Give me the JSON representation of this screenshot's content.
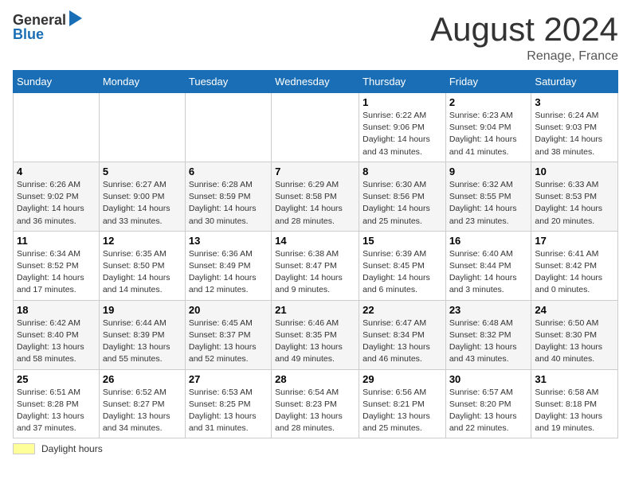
{
  "header": {
    "logo_general": "General",
    "logo_blue": "Blue",
    "month_title": "August 2024",
    "subtitle": "Renage, France"
  },
  "days_of_week": [
    "Sunday",
    "Monday",
    "Tuesday",
    "Wednesday",
    "Thursday",
    "Friday",
    "Saturday"
  ],
  "footer": {
    "legend_label": "Daylight hours"
  },
  "weeks": [
    [
      {
        "day": "",
        "info": ""
      },
      {
        "day": "",
        "info": ""
      },
      {
        "day": "",
        "info": ""
      },
      {
        "day": "",
        "info": ""
      },
      {
        "day": "1",
        "info": "Sunrise: 6:22 AM\nSunset: 9:06 PM\nDaylight: 14 hours and 43 minutes."
      },
      {
        "day": "2",
        "info": "Sunrise: 6:23 AM\nSunset: 9:04 PM\nDaylight: 14 hours and 41 minutes."
      },
      {
        "day": "3",
        "info": "Sunrise: 6:24 AM\nSunset: 9:03 PM\nDaylight: 14 hours and 38 minutes."
      }
    ],
    [
      {
        "day": "4",
        "info": "Sunrise: 6:26 AM\nSunset: 9:02 PM\nDaylight: 14 hours and 36 minutes."
      },
      {
        "day": "5",
        "info": "Sunrise: 6:27 AM\nSunset: 9:00 PM\nDaylight: 14 hours and 33 minutes."
      },
      {
        "day": "6",
        "info": "Sunrise: 6:28 AM\nSunset: 8:59 PM\nDaylight: 14 hours and 30 minutes."
      },
      {
        "day": "7",
        "info": "Sunrise: 6:29 AM\nSunset: 8:58 PM\nDaylight: 14 hours and 28 minutes."
      },
      {
        "day": "8",
        "info": "Sunrise: 6:30 AM\nSunset: 8:56 PM\nDaylight: 14 hours and 25 minutes."
      },
      {
        "day": "9",
        "info": "Sunrise: 6:32 AM\nSunset: 8:55 PM\nDaylight: 14 hours and 23 minutes."
      },
      {
        "day": "10",
        "info": "Sunrise: 6:33 AM\nSunset: 8:53 PM\nDaylight: 14 hours and 20 minutes."
      }
    ],
    [
      {
        "day": "11",
        "info": "Sunrise: 6:34 AM\nSunset: 8:52 PM\nDaylight: 14 hours and 17 minutes."
      },
      {
        "day": "12",
        "info": "Sunrise: 6:35 AM\nSunset: 8:50 PM\nDaylight: 14 hours and 14 minutes."
      },
      {
        "day": "13",
        "info": "Sunrise: 6:36 AM\nSunset: 8:49 PM\nDaylight: 14 hours and 12 minutes."
      },
      {
        "day": "14",
        "info": "Sunrise: 6:38 AM\nSunset: 8:47 PM\nDaylight: 14 hours and 9 minutes."
      },
      {
        "day": "15",
        "info": "Sunrise: 6:39 AM\nSunset: 8:45 PM\nDaylight: 14 hours and 6 minutes."
      },
      {
        "day": "16",
        "info": "Sunrise: 6:40 AM\nSunset: 8:44 PM\nDaylight: 14 hours and 3 minutes."
      },
      {
        "day": "17",
        "info": "Sunrise: 6:41 AM\nSunset: 8:42 PM\nDaylight: 14 hours and 0 minutes."
      }
    ],
    [
      {
        "day": "18",
        "info": "Sunrise: 6:42 AM\nSunset: 8:40 PM\nDaylight: 13 hours and 58 minutes."
      },
      {
        "day": "19",
        "info": "Sunrise: 6:44 AM\nSunset: 8:39 PM\nDaylight: 13 hours and 55 minutes."
      },
      {
        "day": "20",
        "info": "Sunrise: 6:45 AM\nSunset: 8:37 PM\nDaylight: 13 hours and 52 minutes."
      },
      {
        "day": "21",
        "info": "Sunrise: 6:46 AM\nSunset: 8:35 PM\nDaylight: 13 hours and 49 minutes."
      },
      {
        "day": "22",
        "info": "Sunrise: 6:47 AM\nSunset: 8:34 PM\nDaylight: 13 hours and 46 minutes."
      },
      {
        "day": "23",
        "info": "Sunrise: 6:48 AM\nSunset: 8:32 PM\nDaylight: 13 hours and 43 minutes."
      },
      {
        "day": "24",
        "info": "Sunrise: 6:50 AM\nSunset: 8:30 PM\nDaylight: 13 hours and 40 minutes."
      }
    ],
    [
      {
        "day": "25",
        "info": "Sunrise: 6:51 AM\nSunset: 8:28 PM\nDaylight: 13 hours and 37 minutes."
      },
      {
        "day": "26",
        "info": "Sunrise: 6:52 AM\nSunset: 8:27 PM\nDaylight: 13 hours and 34 minutes."
      },
      {
        "day": "27",
        "info": "Sunrise: 6:53 AM\nSunset: 8:25 PM\nDaylight: 13 hours and 31 minutes."
      },
      {
        "day": "28",
        "info": "Sunrise: 6:54 AM\nSunset: 8:23 PM\nDaylight: 13 hours and 28 minutes."
      },
      {
        "day": "29",
        "info": "Sunrise: 6:56 AM\nSunset: 8:21 PM\nDaylight: 13 hours and 25 minutes."
      },
      {
        "day": "30",
        "info": "Sunrise: 6:57 AM\nSunset: 8:20 PM\nDaylight: 13 hours and 22 minutes."
      },
      {
        "day": "31",
        "info": "Sunrise: 6:58 AM\nSunset: 8:18 PM\nDaylight: 13 hours and 19 minutes."
      }
    ]
  ]
}
